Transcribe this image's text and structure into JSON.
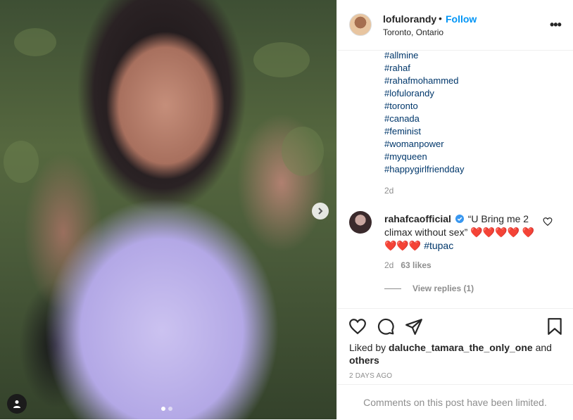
{
  "post": {
    "carousel": {
      "slide_count": 2,
      "active_slide": 1
    }
  },
  "header": {
    "username": "lofulorandy",
    "separator": "•",
    "follow_label": "Follow",
    "location": "Toronto, Ontario",
    "more_label": "•••"
  },
  "caption": {
    "hashtags": [
      "#allmine",
      "#rahaf",
      "#rahafmohammed",
      "#lofulorandy",
      "#toronto",
      "#canada",
      "#feminist",
      "#womanpower",
      "#myqueen",
      "#happygirlfriendday"
    ],
    "time": "2d"
  },
  "comment": {
    "username": "rahafcaofficial",
    "text": "“U Bring me 2 climax without sex”",
    "hearts_line1": "❤️❤️❤️❤️",
    "hearts_line2": "❤️❤️❤️❤️",
    "hashtag": "#tupac",
    "time": "2d",
    "likes": "63 likes",
    "view_replies": "View replies (1)"
  },
  "actions": {
    "liked_by_prefix": "Liked by",
    "liked_by_user": "daluche_tamara_the_only_one",
    "liked_by_and": "and",
    "liked_by_others": "others",
    "posted_time": "2 DAYS AGO"
  },
  "footer": {
    "comments_limited": "Comments on this post have been limited."
  },
  "colors": {
    "link": "#00376b",
    "follow": "#0095f6",
    "muted": "#8e8e8e",
    "heart": "#e0245e"
  }
}
